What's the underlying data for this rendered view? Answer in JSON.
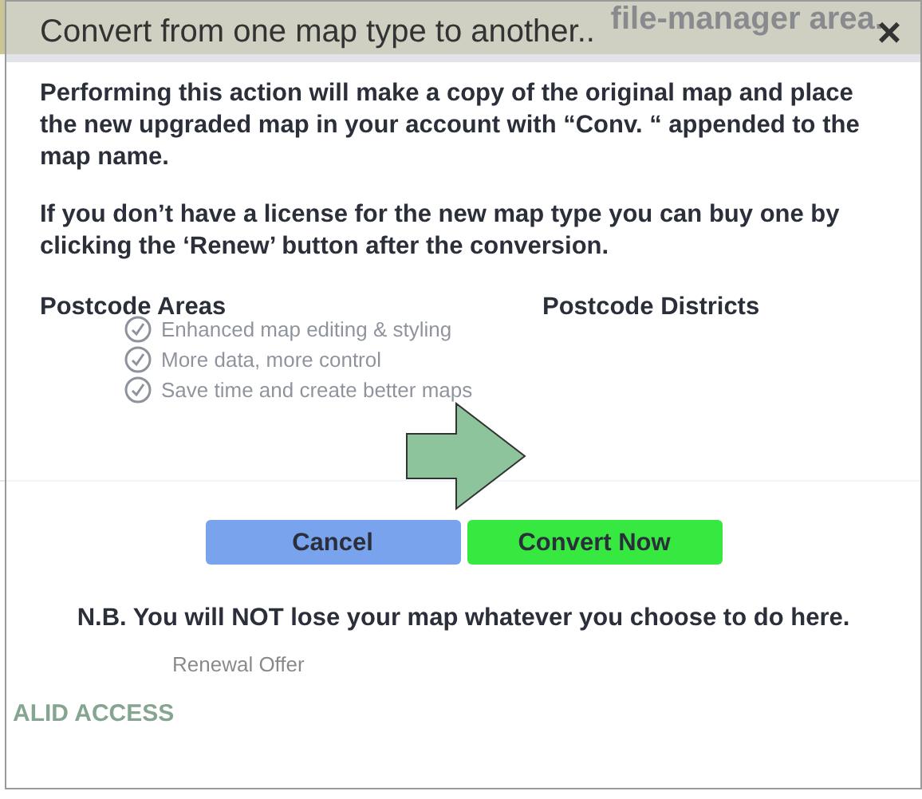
{
  "background_page": {
    "banner_text": "file-manager area.",
    "features": [
      "Enhanced map editing & styling",
      "More data, more control",
      "Save time and create better maps"
    ],
    "renewal_offer": "Renewal Offer",
    "access_status": "ALID ACCESS"
  },
  "dialog": {
    "title": "Convert from one map type to another..",
    "close_icon": "×",
    "paragraphs": [
      "Performing this action will make a copy of the original map and place the new upgraded map in your account with “Conv. “ appended to the map name.",
      "If you don’t have a license for the new map type you can buy one by clicking the ‘Renew’ button after the conversion."
    ],
    "from_label": "Postcode Areas",
    "to_label": "Postcode Districts",
    "buttons": [
      {
        "label": "Cancel",
        "kind": "secondary"
      },
      {
        "label": "Convert Now",
        "kind": "primary"
      }
    ],
    "note": "N.B. You will NOT lose your map whatever you choose to do here."
  }
}
